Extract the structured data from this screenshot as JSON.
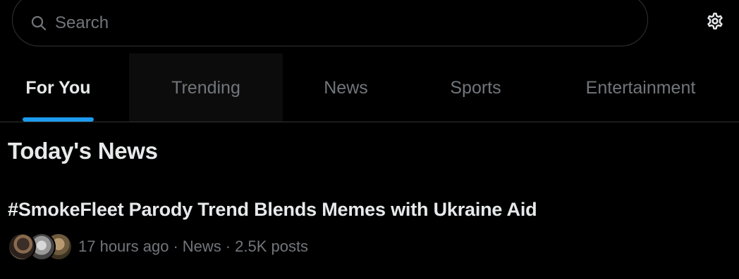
{
  "search": {
    "placeholder": "Search",
    "value": ""
  },
  "icons": {
    "search": "search-icon",
    "settings": "gear-icon"
  },
  "tabs": [
    {
      "label": "For You",
      "active": true
    },
    {
      "label": "Trending",
      "active": false
    },
    {
      "label": "News",
      "active": false
    },
    {
      "label": "Sports",
      "active": false
    },
    {
      "label": "Entertainment",
      "active": false
    }
  ],
  "section": {
    "title": "Today's News"
  },
  "story": {
    "headline": "#SmokeFleet Parody Trend Blends Memes with Ukraine Aid",
    "time": "17 hours ago",
    "category": "News",
    "posts": "2.5K posts",
    "separator": "·"
  },
  "colors": {
    "background": "#000000",
    "accent": "#1d9bf0",
    "text_primary": "#e7e9ea",
    "text_secondary": "#71767b",
    "border": "#2f3336"
  }
}
